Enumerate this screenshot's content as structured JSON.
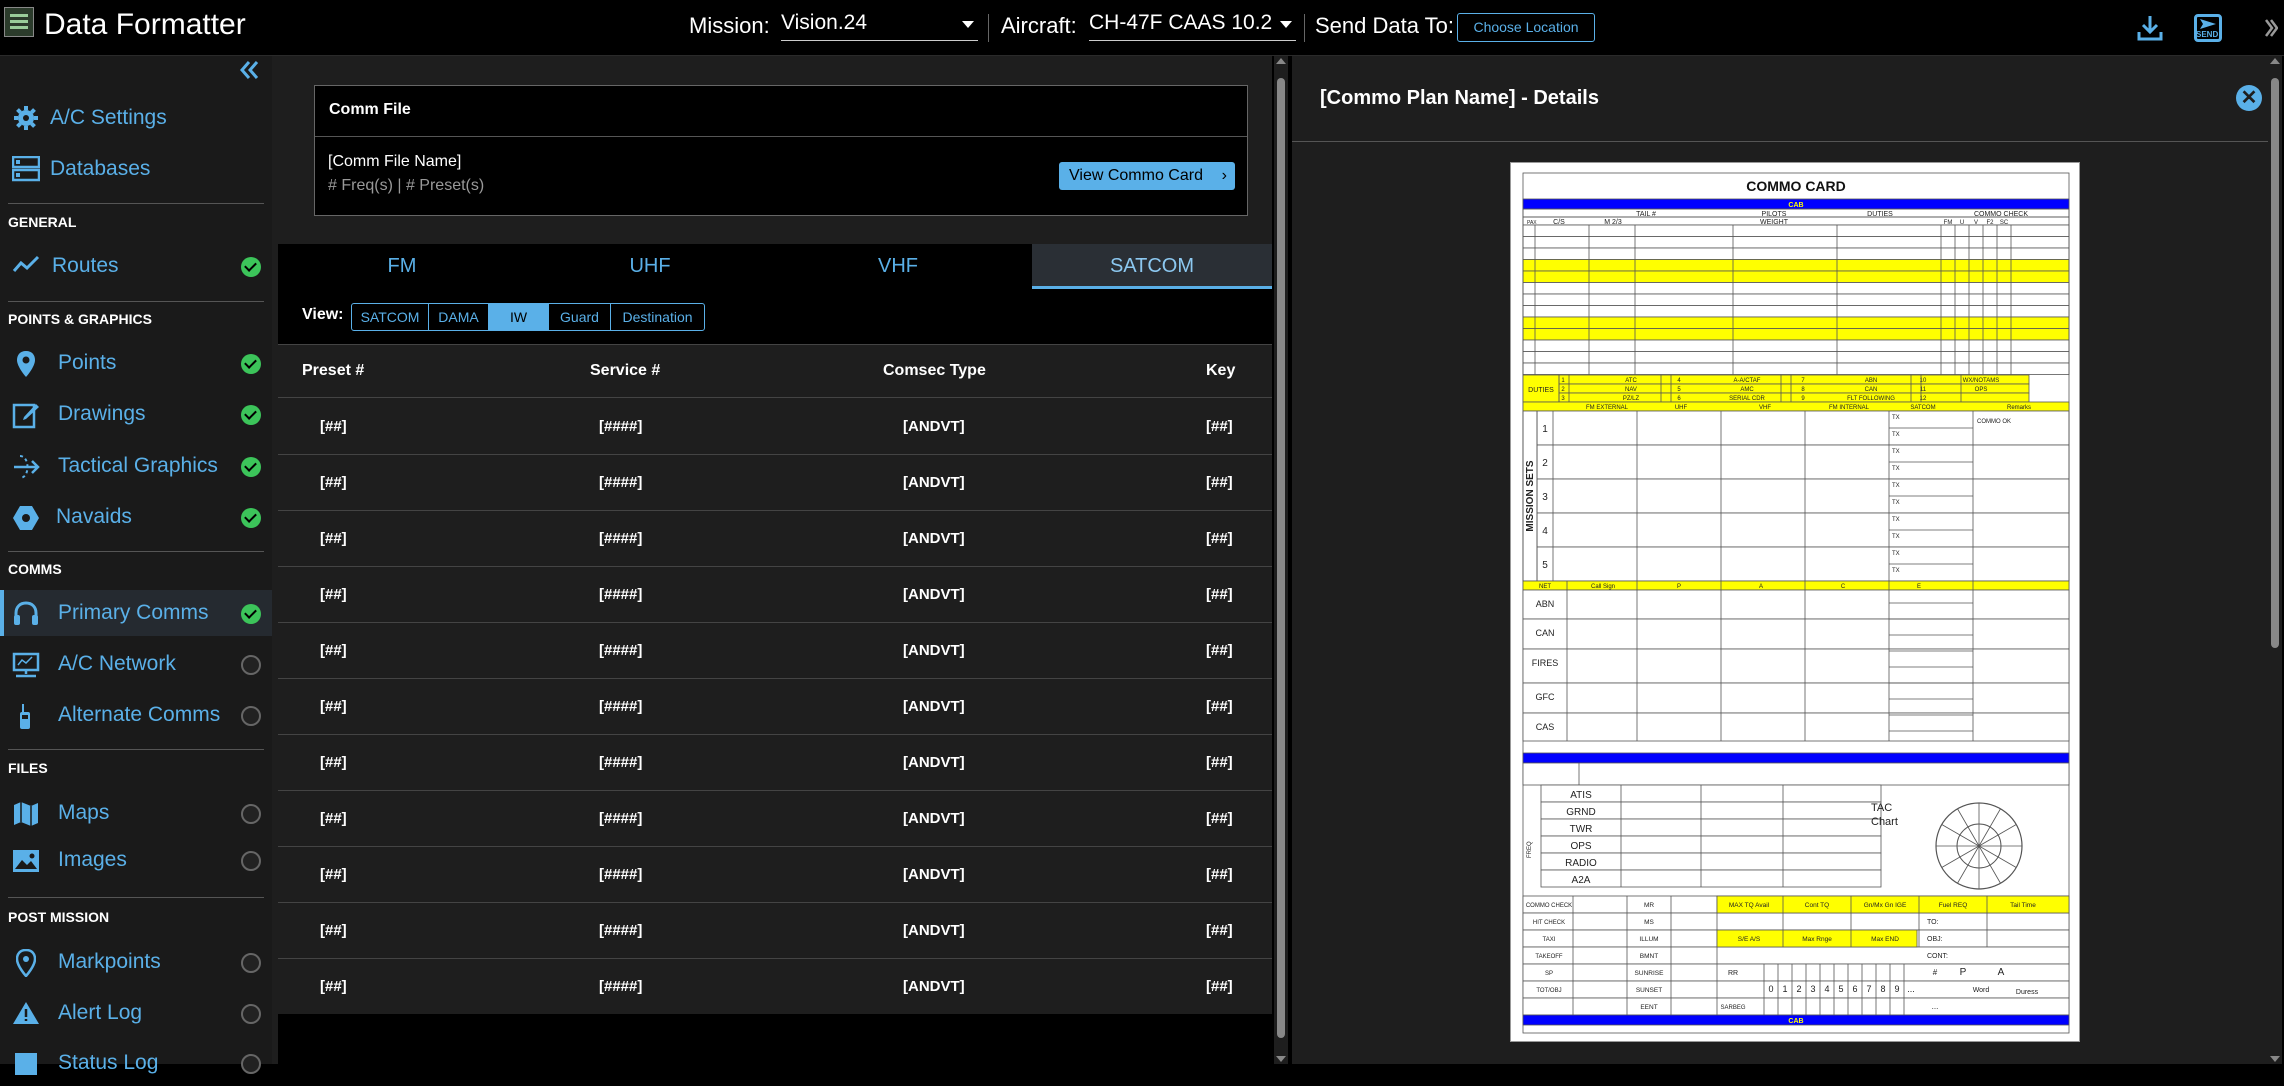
{
  "header": {
    "app_title": "Data Formatter",
    "mission_label": "Mission:",
    "mission_value": "Vision.24",
    "aircraft_label": "Aircraft:",
    "aircraft_value": "CH-47F CAAS 10.2",
    "send_label": "Send Data To:",
    "choose_location": "Choose Location",
    "send_icon_text": "SEND"
  },
  "sidebar": {
    "top_items": [
      {
        "label": "A/C Settings",
        "icon": "gear-icon"
      },
      {
        "label": "Databases",
        "icon": "database-icon"
      }
    ],
    "sections": [
      {
        "title": "GENERAL",
        "items": [
          {
            "label": "Routes",
            "status": "complete"
          }
        ]
      },
      {
        "title": "POINTS & GRAPHICS",
        "items": [
          {
            "label": "Points",
            "status": "complete"
          },
          {
            "label": "Drawings",
            "status": "complete"
          },
          {
            "label": "Tactical Graphics",
            "status": "complete"
          },
          {
            "label": "Navaids",
            "status": "complete"
          }
        ]
      },
      {
        "title": "COMMS",
        "items": [
          {
            "label": "Primary Comms",
            "status": "complete",
            "active": true
          },
          {
            "label": "A/C Network",
            "status": "pending"
          },
          {
            "label": "Alternate Comms",
            "status": "pending"
          }
        ]
      },
      {
        "title": "FILES",
        "items": [
          {
            "label": "Maps",
            "status": "pending"
          },
          {
            "label": "Images",
            "status": "pending"
          }
        ]
      },
      {
        "title": "POST MISSION",
        "items": [
          {
            "label": "Markpoints",
            "status": "pending"
          },
          {
            "label": "Alert Log",
            "status": "pending"
          },
          {
            "label": "Status Log",
            "status": "pending"
          }
        ]
      }
    ]
  },
  "comm_file": {
    "title": "Comm File",
    "name": "[Comm File Name]",
    "subtitle": "# Freq(s) | # Preset(s)",
    "view_button": "View Commo Card"
  },
  "tabs": [
    "FM",
    "UHF",
    "VHF",
    "SATCOM"
  ],
  "active_tab": "SATCOM",
  "view": {
    "label": "View:",
    "options": [
      "SATCOM",
      "DAMA",
      "IW",
      "Guard",
      "Destination"
    ],
    "active": "IW"
  },
  "table": {
    "columns": [
      "Preset #",
      "Service #",
      "Comsec Type",
      "Key"
    ],
    "rows": [
      [
        "[##]",
        "[####]",
        "[ANDVT]",
        "[##]"
      ],
      [
        "[##]",
        "[####]",
        "[ANDVT]",
        "[##]"
      ],
      [
        "[##]",
        "[####]",
        "[ANDVT]",
        "[##]"
      ],
      [
        "[##]",
        "[####]",
        "[ANDVT]",
        "[##]"
      ],
      [
        "[##]",
        "[####]",
        "[ANDVT]",
        "[##]"
      ],
      [
        "[##]",
        "[####]",
        "[ANDVT]",
        "[##]"
      ],
      [
        "[##]",
        "[####]",
        "[ANDVT]",
        "[##]"
      ],
      [
        "[##]",
        "[####]",
        "[ANDVT]",
        "[##]"
      ],
      [
        "[##]",
        "[####]",
        "[ANDVT]",
        "[##]"
      ],
      [
        "[##]",
        "[####]",
        "[ANDVT]",
        "[##]"
      ],
      [
        "[##]",
        "[####]",
        "[ANDVT]",
        "[##]"
      ]
    ]
  },
  "details": {
    "title": "[Commo Plan Name] - Details"
  },
  "commo_card": {
    "title": "COMMO CARD",
    "cab": "CAB",
    "hdr1": [
      "TAIL #",
      "PILOTS",
      "DUTIES",
      "COMMO CHECK"
    ],
    "hdr2": [
      "PAX",
      "C/S",
      "M 2/3",
      "WEIGHT",
      "FM",
      "U",
      "V",
      "F2",
      "SC"
    ],
    "duties_label": "DUTIES",
    "duties": [
      [
        "1",
        "ATC",
        "4",
        "A-A/CTAF",
        "7",
        "ABN",
        "10",
        "WX/NOTAMS"
      ],
      [
        "2",
        "NAV",
        "5",
        "AMC",
        "8",
        "CAN",
        "11",
        "OPS"
      ],
      [
        "3",
        "PZ/LZ",
        "6",
        "SERIAL CDR",
        "9",
        "FLT FOLLOWING",
        "12",
        ""
      ]
    ],
    "sets_header": [
      "FM EXTERNAL",
      "UHF",
      "VHF",
      "FM INTERNAL",
      "SATCOM",
      "Remarks"
    ],
    "mission_sets_label": "MISSION SETS",
    "set_numbers": [
      "1",
      "2",
      "3",
      "4",
      "5"
    ],
    "tx": "TX",
    "commo_ok": "COMMO OK",
    "net_header": [
      "NET",
      "Call Sign",
      "P",
      "A",
      "C",
      "E"
    ],
    "nets": [
      "ABN",
      "CAN",
      "FIRES",
      "GFC",
      "CAS"
    ],
    "freq_label": "FREQ",
    "freq_rows": [
      "ATIS",
      "GRND",
      "TWR",
      "OPS",
      "RADIO",
      "A2A"
    ],
    "tac_chart": [
      "TAC",
      "Chart"
    ],
    "bottom_left": [
      "COMMO CHECK",
      "HIT CHECK",
      "TAXI",
      "TAKEOFF",
      "SP",
      "TOT/OBJ"
    ],
    "bottom_mid": [
      "MR",
      "MS",
      "ILLUM",
      "BMNT",
      "SUNRISE",
      "SUNSET",
      "EENT"
    ],
    "perf_row1": [
      "MAX TQ Avail",
      "Cont TQ",
      "Gn/Mx Gn IGE",
      "Fuel REQ",
      "Tail Time"
    ],
    "perf_row2": [
      "S/E A/S",
      "Max Rnge",
      "Max END"
    ],
    "to_labels": [
      "TO:",
      "OBJ:",
      "CONT:"
    ],
    "rr": "RR",
    "hash": "#",
    "p": "P",
    "a": "A",
    "digits": [
      "0",
      "1",
      "2",
      "3",
      "4",
      "5",
      "6",
      "7",
      "8",
      "9",
      "..."
    ],
    "word": "Word",
    "duress": "Duress",
    "sarbeg": "SARBEG",
    "ellipsis": "..."
  },
  "colors": {
    "accent": "#5ab0e8",
    "success": "#3cc45a",
    "card_yellow": "#ffff00",
    "card_blue": "#0000ff"
  }
}
